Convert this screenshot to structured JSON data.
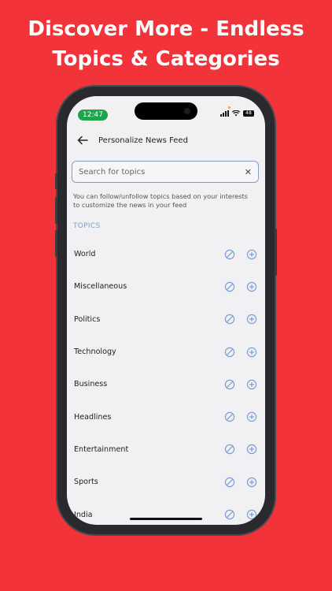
{
  "promo": {
    "line1": "Discover More - Endless",
    "line2": "Topics & Categories"
  },
  "status_bar": {
    "time": "12:47",
    "battery": "48"
  },
  "header": {
    "title": "Personalize News Feed"
  },
  "search": {
    "placeholder": "Search for topics",
    "value": ""
  },
  "helper_text": "You can follow/unfollow topics based on your interests to customize the news in your feed",
  "section_label": "TOPICS",
  "topics": [
    {
      "label": "World"
    },
    {
      "label": "Miscellaneous"
    },
    {
      "label": "Politics"
    },
    {
      "label": "Technology"
    },
    {
      "label": "Business"
    },
    {
      "label": "Headlines"
    },
    {
      "label": "Entertainment"
    },
    {
      "label": "Sports"
    },
    {
      "label": "India"
    }
  ],
  "icons": {
    "back": "arrow-left-icon",
    "clear": "close-icon",
    "block": "block-icon",
    "follow": "plus-circle-icon"
  },
  "colors": {
    "background": "#f3333a",
    "accent": "#7c9fd4",
    "status_time_bg": "#1fa44b"
  }
}
